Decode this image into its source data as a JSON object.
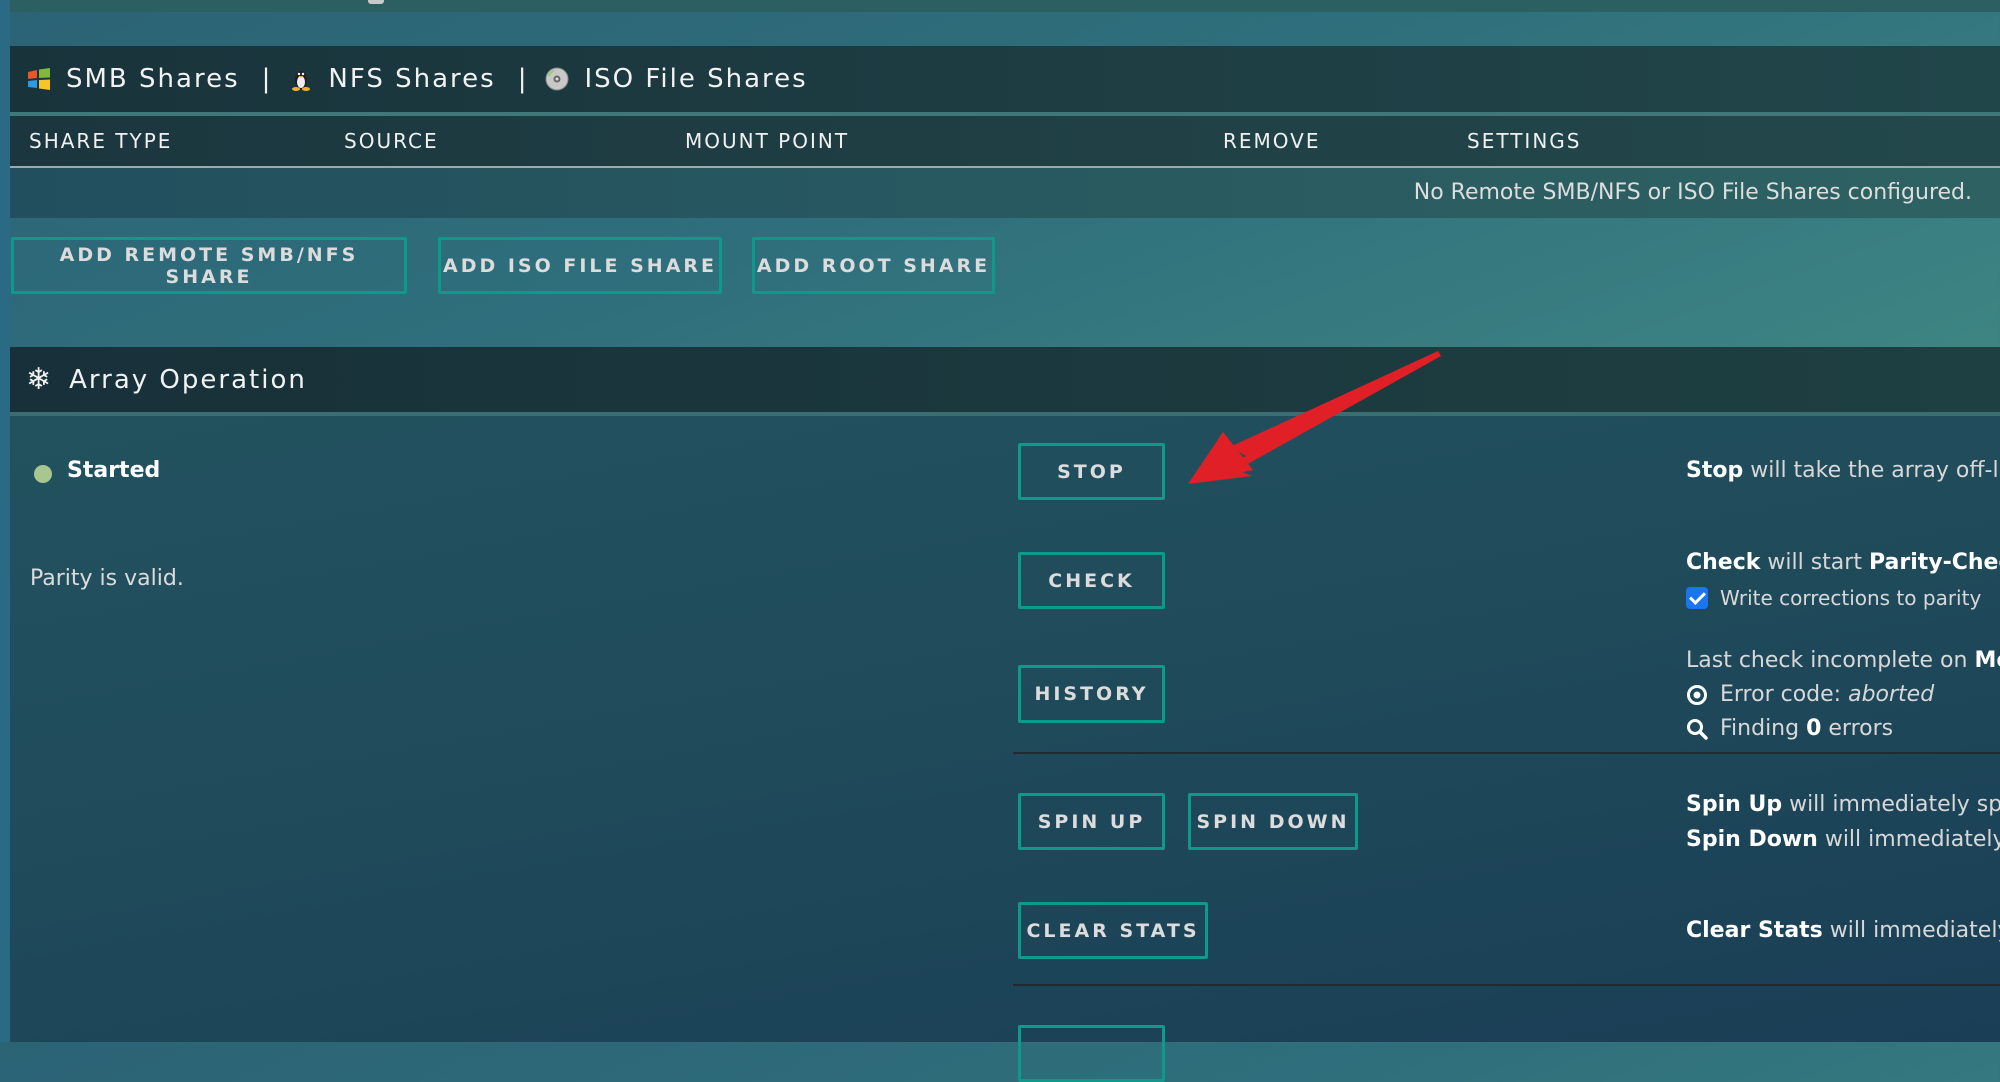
{
  "shares": {
    "tabs": [
      {
        "label": "SMB Shares",
        "icon": "windows-logo-icon"
      },
      {
        "label": "NFS Shares",
        "icon": "linux-tux-icon"
      },
      {
        "label": "ISO File Shares",
        "icon": "disc-icon"
      }
    ],
    "separator": "|",
    "table": {
      "columns": [
        "SHARE TYPE",
        "SOURCE",
        "MOUNT POINT",
        "REMOVE",
        "SETTINGS"
      ],
      "empty_message": "No Remote SMB/NFS or ISO File Shares configured."
    },
    "buttons": {
      "add_remote": "ADD REMOTE SMB/NFS SHARE",
      "add_iso": "ADD ISO FILE SHARE",
      "add_root": "ADD ROOT SHARE"
    }
  },
  "array_operation": {
    "title": "Array Operation",
    "icon": "snowflake-icon",
    "status": {
      "label": "Started",
      "color": "#a8c690"
    },
    "parity_text": "Parity is valid.",
    "buttons": {
      "stop": "STOP",
      "check": "CHECK",
      "history": "HISTORY",
      "spin_up": "SPIN UP",
      "spin_down": "SPIN DOWN",
      "clear_stats": "CLEAR STATS"
    },
    "descriptions": {
      "stop_bold": "Stop",
      "stop_rest": " will take the array off-li",
      "check_bold": "Check",
      "check_mid": " will start ",
      "check_bold2": "Parity-Chec",
      "write_corrections_label": "Write corrections to parity",
      "write_corrections_checked": true,
      "last_check": "Last check incomplete on ",
      "last_check_bold": "Mo",
      "error_code_label": "Error code: ",
      "error_code_value": "aborted",
      "finding_pre": "Finding ",
      "finding_count": "0",
      "finding_post": " errors",
      "spin_up_bold": "Spin Up",
      "spin_up_rest": " will immediately spi",
      "spin_down_bold": "Spin Down",
      "spin_down_rest": " will immediately",
      "clear_stats_bold": "Clear Stats",
      "clear_stats_rest": " will immediately"
    }
  },
  "colors": {
    "button_border": "#0d9a8a",
    "annotation_arrow": "#e01f26",
    "checkbox": "#1976f0"
  }
}
